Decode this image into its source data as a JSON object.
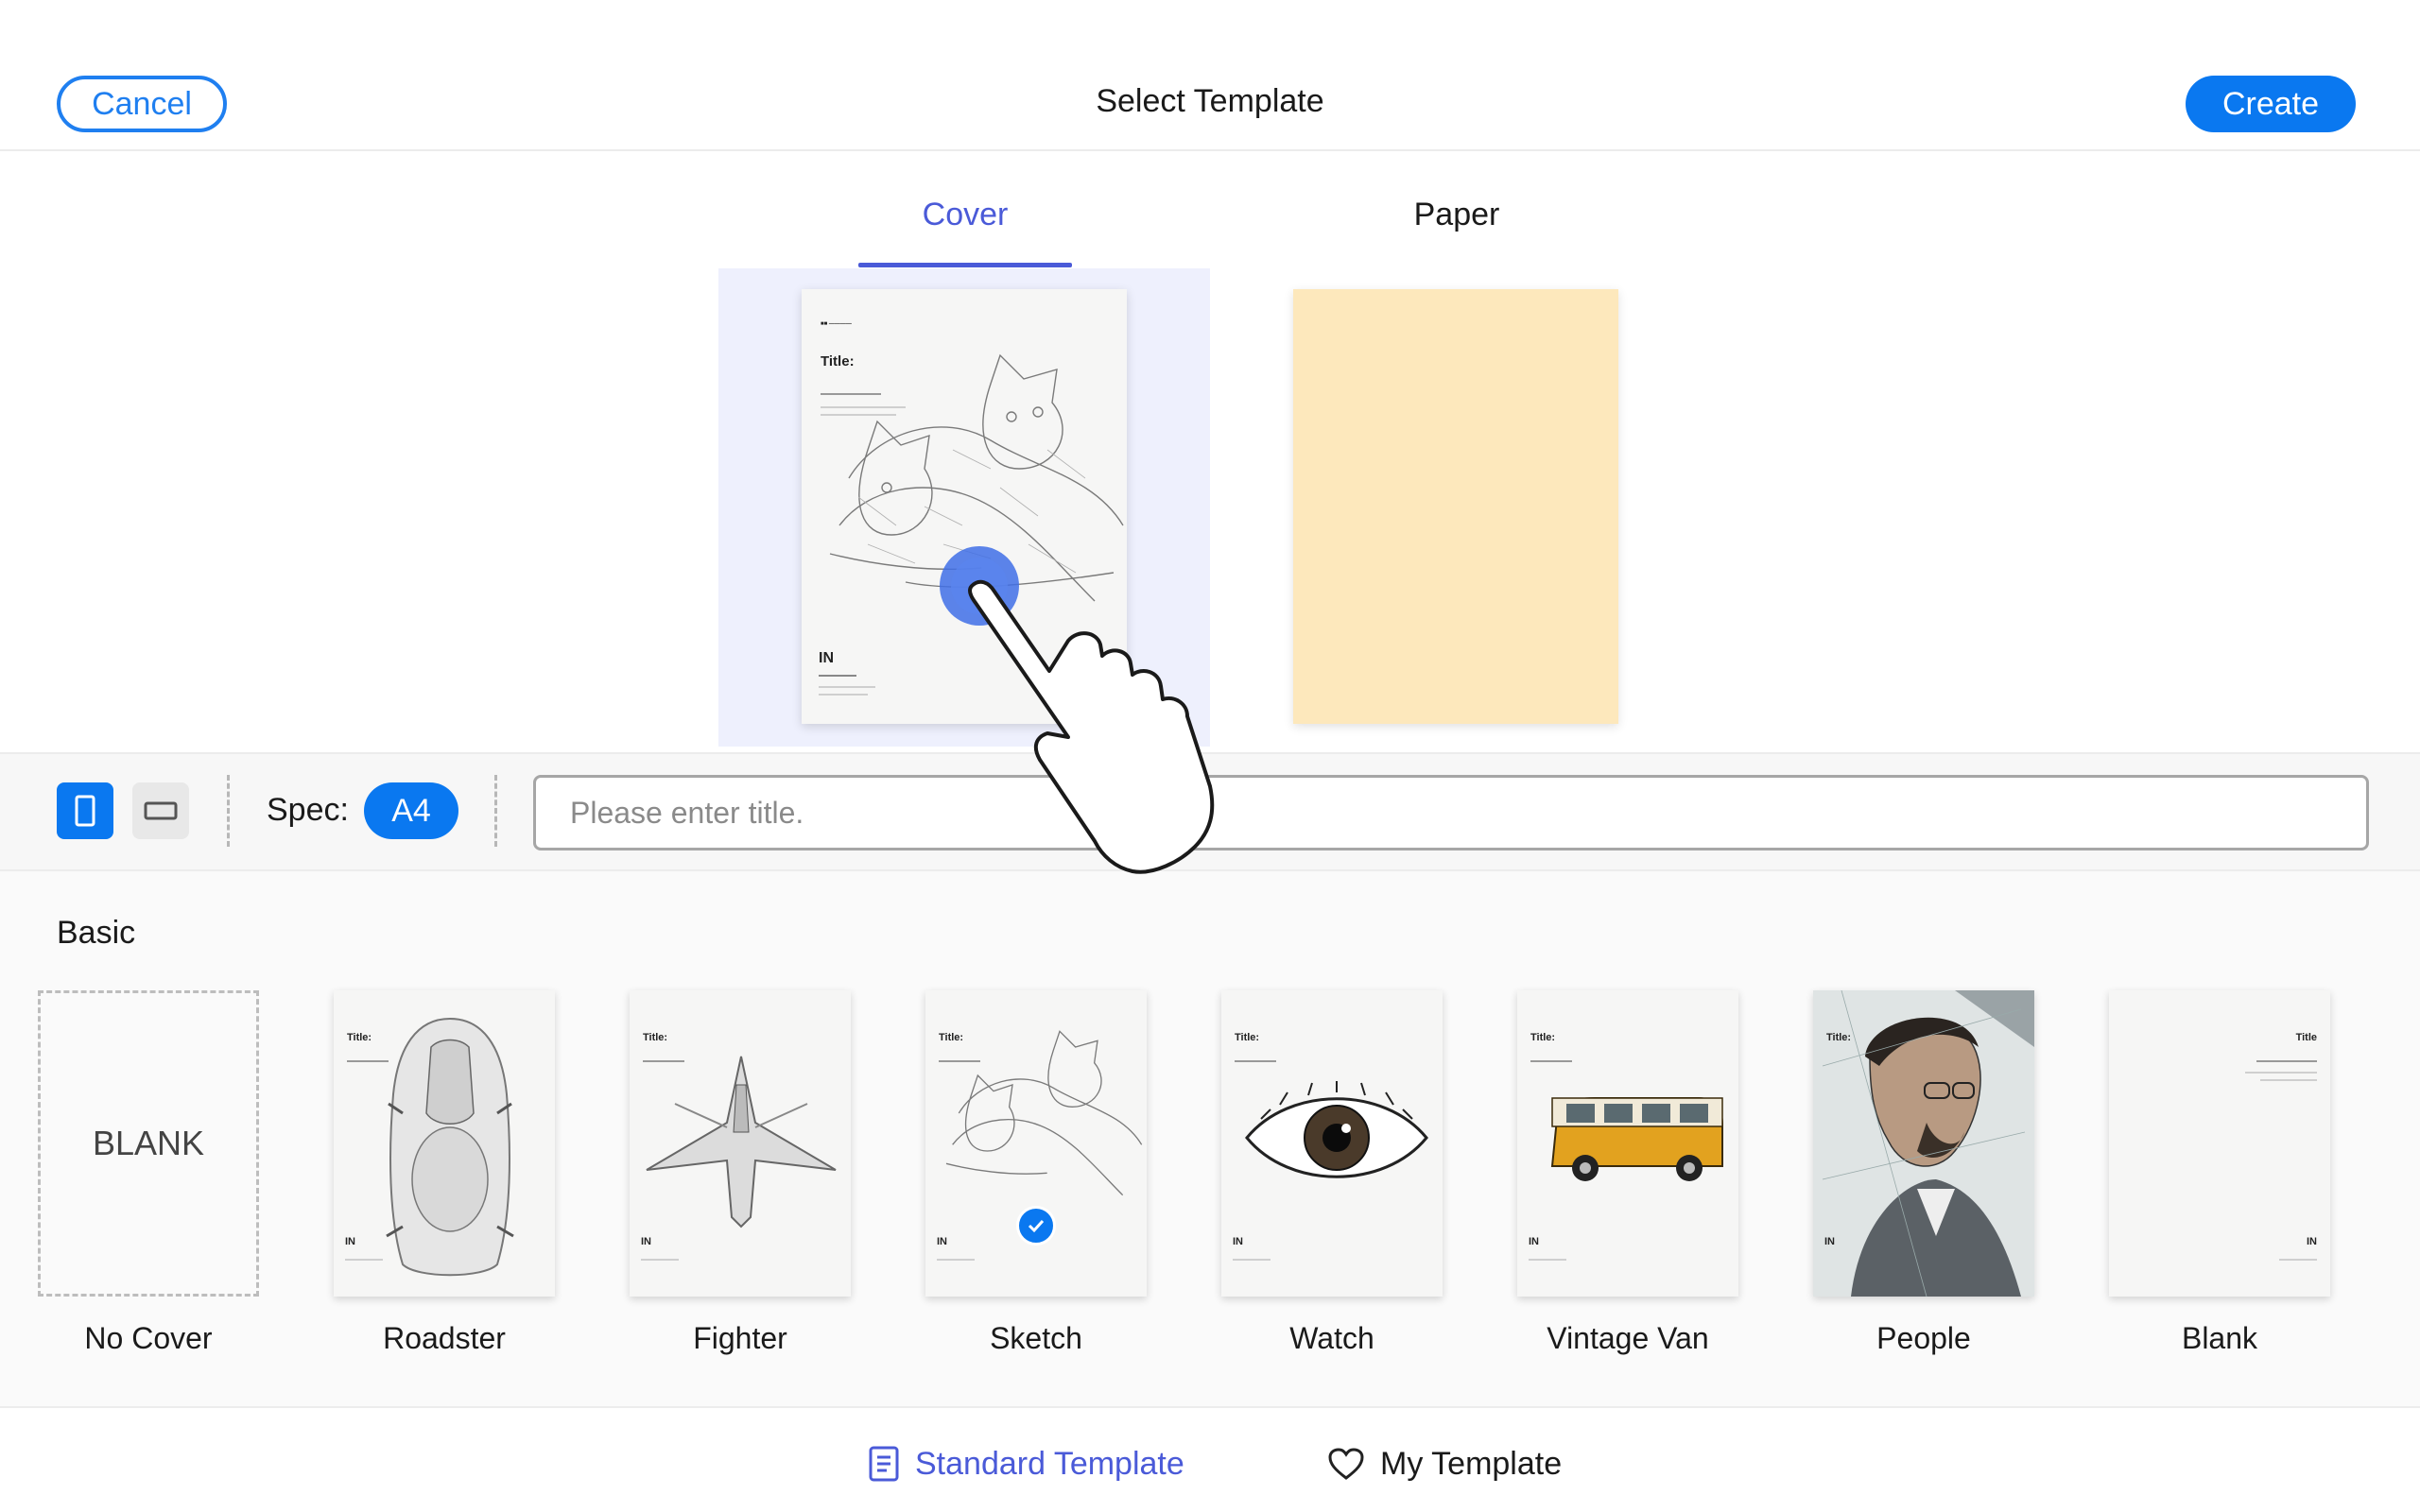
{
  "header": {
    "cancel_label": "Cancel",
    "title": "Select Template",
    "create_label": "Create"
  },
  "tabs": {
    "cover": "Cover",
    "paper": "Paper",
    "active": "Cover"
  },
  "preview": {
    "cover_title": "Title",
    "paper_color": "#fde8bc"
  },
  "toolbar": {
    "orientation_selected": "portrait",
    "spec_label": "Spec:",
    "spec_value": "A4",
    "title_placeholder": "Please enter title."
  },
  "basic": {
    "section_label": "Basic",
    "blank_text": "BLANK",
    "templates": [
      {
        "label": "No Cover"
      },
      {
        "label": "Roadster"
      },
      {
        "label": "Fighter"
      },
      {
        "label": "Sketch",
        "selected": true
      },
      {
        "label": "Watch"
      },
      {
        "label": "Vintage Van"
      },
      {
        "label": "People"
      },
      {
        "label": "Blank"
      }
    ]
  },
  "bottom_tabs": {
    "standard": "Standard Template",
    "my": "My Template",
    "active": "Standard Template"
  },
  "colors": {
    "accent_blue": "#0a78f0",
    "tab_active": "#4a5ad8",
    "cover_highlight": "#eef0fd"
  }
}
